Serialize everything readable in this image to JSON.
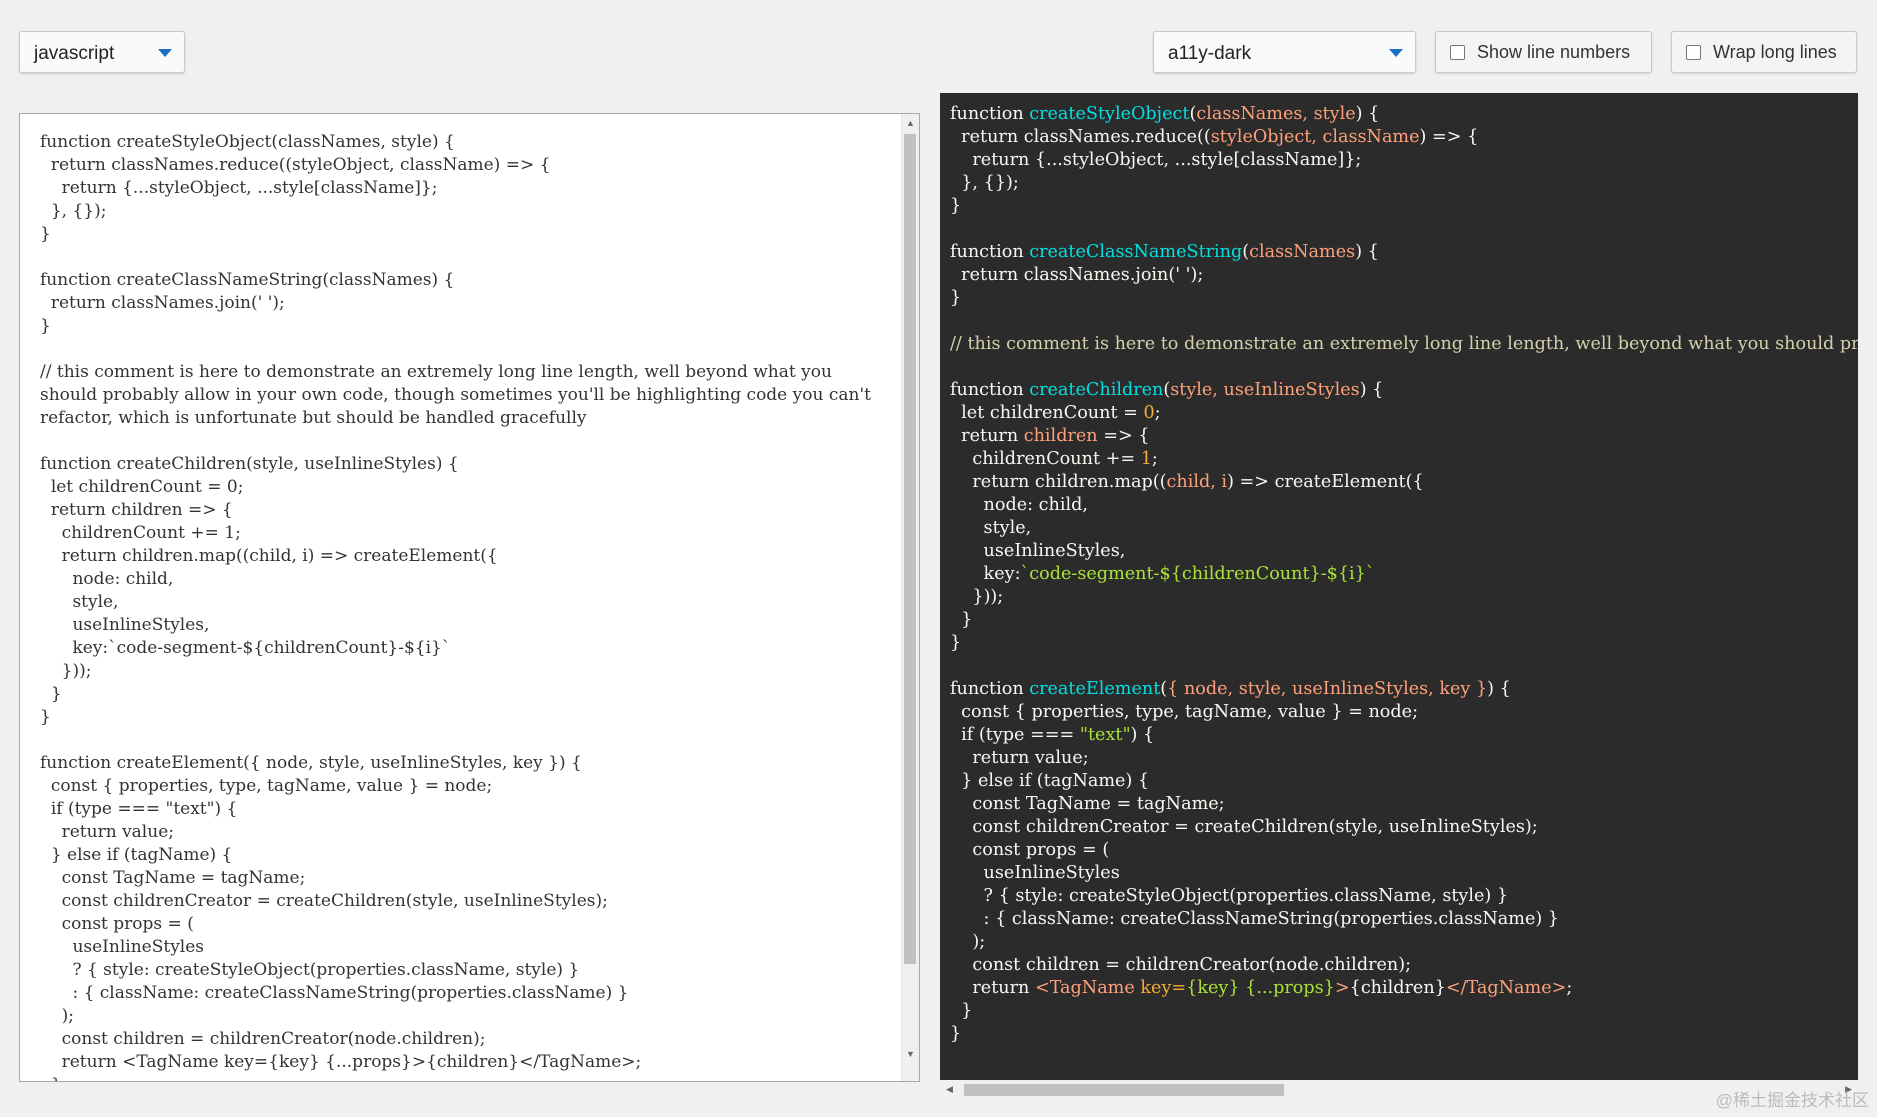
{
  "toolbar": {
    "language": "javascript",
    "theme": "a11y-dark",
    "show_line_numbers": "Show line numbers",
    "wrap_long_lines": "Wrap long lines"
  },
  "editor": {
    "code": "function createStyleObject(classNames, style) {\n  return classNames.reduce((styleObject, className) => {\n    return {...styleObject, ...style[className]};\n  }, {});\n}\n\nfunction createClassNameString(classNames) {\n  return classNames.join(' ');\n}\n\n// this comment is here to demonstrate an extremely long line length, well beyond what you should probably allow in your own code, though sometimes you'll be highlighting code you can't refactor, which is unfortunate but should be handled gracefully\n\nfunction createChildren(style, useInlineStyles) {\n  let childrenCount = 0;\n  return children => {\n    childrenCount += 1;\n    return children.map((child, i) => createElement({\n      node: child,\n      style,\n      useInlineStyles,\n      key:`code-segment-${childrenCount}-${i}`\n    }));\n  }\n}\n\nfunction createElement({ node, style, useInlineStyles, key }) {\n  const { properties, type, tagName, value } = node;\n  if (type === \"text\") {\n    return value;\n  } else if (tagName) {\n    const TagName = tagName;\n    const childrenCreator = createChildren(style, useInlineStyles);\n    const props = (\n      useInlineStyles\n      ? { style: createStyleObject(properties.className, style) }\n      : { className: createClassNameString(properties.className) }\n    );\n    const children = childrenCreator(node.children);\n    return <TagName key={key} {...props}>{children}</TagName>;\n  }\n}"
  },
  "preview": {
    "lines": [
      [
        [
          "function ",
          ""
        ],
        [
          "createStyleObject",
          "fn"
        ],
        [
          "(",
          ""
        ],
        [
          "classNames, style",
          "pa"
        ],
        [
          ") {",
          ""
        ]
      ],
      [
        [
          "  return classNames.reduce((",
          ""
        ],
        [
          "styleObject, className",
          "pa"
        ],
        [
          ") => {",
          ""
        ]
      ],
      [
        [
          "    return {...styleObject, ...style[className]};",
          ""
        ]
      ],
      [
        [
          "  }, {});",
          ""
        ]
      ],
      [
        [
          "}",
          ""
        ]
      ],
      [
        [
          "",
          ""
        ]
      ],
      [
        [
          "function ",
          ""
        ],
        [
          "createClassNameString",
          "fn"
        ],
        [
          "(",
          ""
        ],
        [
          "classNames",
          "pa"
        ],
        [
          ") {",
          ""
        ]
      ],
      [
        [
          "  return classNames.join(' ');",
          ""
        ]
      ],
      [
        [
          "}",
          ""
        ]
      ],
      [
        [
          "",
          ""
        ]
      ],
      [
        [
          "// this comment is here to demonstrate an extremely long line length, well beyond what you should probably allow in your own code, though sometimes you'll be highlighting code you can't refactor, which is unfortunate but should be handled gracefully",
          "cm"
        ]
      ],
      [
        [
          "",
          ""
        ]
      ],
      [
        [
          "function ",
          ""
        ],
        [
          "createChildren",
          "fn"
        ],
        [
          "(",
          ""
        ],
        [
          "style, useInlineStyles",
          "pa"
        ],
        [
          ") {",
          ""
        ]
      ],
      [
        [
          "  let childrenCount = ",
          ""
        ],
        [
          "0",
          "nm"
        ],
        [
          ";",
          ""
        ]
      ],
      [
        [
          "  return ",
          ""
        ],
        [
          "children",
          "pa"
        ],
        [
          " => {",
          ""
        ]
      ],
      [
        [
          "    childrenCount += ",
          ""
        ],
        [
          "1",
          "nm"
        ],
        [
          ";",
          ""
        ]
      ],
      [
        [
          "    return children.map((",
          ""
        ],
        [
          "child, i",
          "pa"
        ],
        [
          ") => createElement({",
          ""
        ]
      ],
      [
        [
          "      node: child,",
          ""
        ]
      ],
      [
        [
          "      style,",
          ""
        ]
      ],
      [
        [
          "      useInlineStyles,",
          ""
        ]
      ],
      [
        [
          "      key:",
          ""
        ],
        [
          "`code-segment-${childrenCount}-${i}`",
          "st"
        ]
      ],
      [
        [
          "    }));",
          ""
        ]
      ],
      [
        [
          "  }",
          ""
        ]
      ],
      [
        [
          "}",
          ""
        ]
      ],
      [
        [
          "",
          ""
        ]
      ],
      [
        [
          "function ",
          ""
        ],
        [
          "createElement",
          "fn"
        ],
        [
          "(",
          ""
        ],
        [
          "{ node, style, useInlineStyles, key }",
          "pa"
        ],
        [
          ") {",
          ""
        ]
      ],
      [
        [
          "  const { properties, type, tagName, value } = node;",
          ""
        ]
      ],
      [
        [
          "  if (type === ",
          ""
        ],
        [
          "\"text\"",
          "st"
        ],
        [
          ") {",
          ""
        ]
      ],
      [
        [
          "    return value;",
          ""
        ]
      ],
      [
        [
          "  } else if (tagName) {",
          ""
        ]
      ],
      [
        [
          "    const TagName = tagName;",
          ""
        ]
      ],
      [
        [
          "    const childrenCreator = createChildren(style, useInlineStyles);",
          ""
        ]
      ],
      [
        [
          "    const props = (",
          ""
        ]
      ],
      [
        [
          "      useInlineStyles",
          ""
        ]
      ],
      [
        [
          "      ? { style: createStyleObject(properties.className, style) }",
          ""
        ]
      ],
      [
        [
          "      : { className: createClassNameString(properties.className) }",
          ""
        ]
      ],
      [
        [
          "    );",
          ""
        ]
      ],
      [
        [
          "    const children = childrenCreator(node.children);",
          ""
        ]
      ],
      [
        [
          "    return ",
          ""
        ],
        [
          "<TagName ",
          "tg"
        ],
        [
          "key=",
          "at"
        ],
        [
          "{key}",
          "st"
        ],
        [
          " ",
          ""
        ],
        [
          "{...props}",
          "st"
        ],
        [
          ">",
          "tg"
        ],
        [
          "{children}",
          ""
        ],
        [
          "</TagName>",
          "tg"
        ],
        [
          ";",
          ""
        ]
      ],
      [
        [
          "  }",
          ""
        ]
      ],
      [
        [
          "}",
          ""
        ]
      ]
    ]
  },
  "watermark": "@稀土掘金技术社区"
}
